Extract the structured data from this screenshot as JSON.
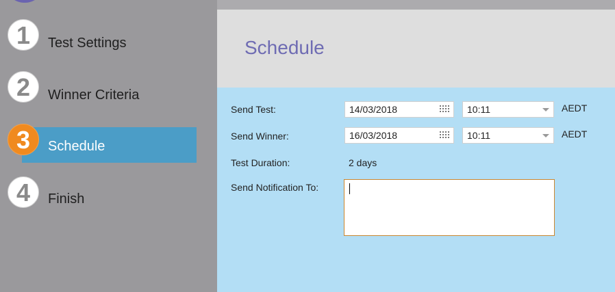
{
  "wizard_steps": [
    {
      "number": "1",
      "label": "Test Settings",
      "active": false
    },
    {
      "number": "2",
      "label": "Winner Criteria",
      "active": false
    },
    {
      "number": "3",
      "label": "Schedule",
      "active": true
    },
    {
      "number": "4",
      "label": "Finish",
      "active": false
    }
  ],
  "header": {
    "title": "Schedule"
  },
  "form": {
    "send_test": {
      "label": "Send Test:",
      "date": "14/03/2018",
      "time": "10:11",
      "timezone": "AEDT"
    },
    "send_winner": {
      "label": "Send Winner:",
      "date": "16/03/2018",
      "time": "10:11",
      "timezone": "AEDT"
    },
    "test_duration": {
      "label": "Test Duration:",
      "value": "2 days"
    },
    "notification": {
      "label": "Send Notification To:",
      "value": ""
    }
  },
  "colors": {
    "active_step": "#f08a1f",
    "active_bar": "#4b9dc7",
    "title": "#6f6cb3",
    "content_bg": "#b3def5"
  },
  "icons": {
    "date_picker": "calendar-icon",
    "time_dropdown": "chevron-down-icon"
  }
}
